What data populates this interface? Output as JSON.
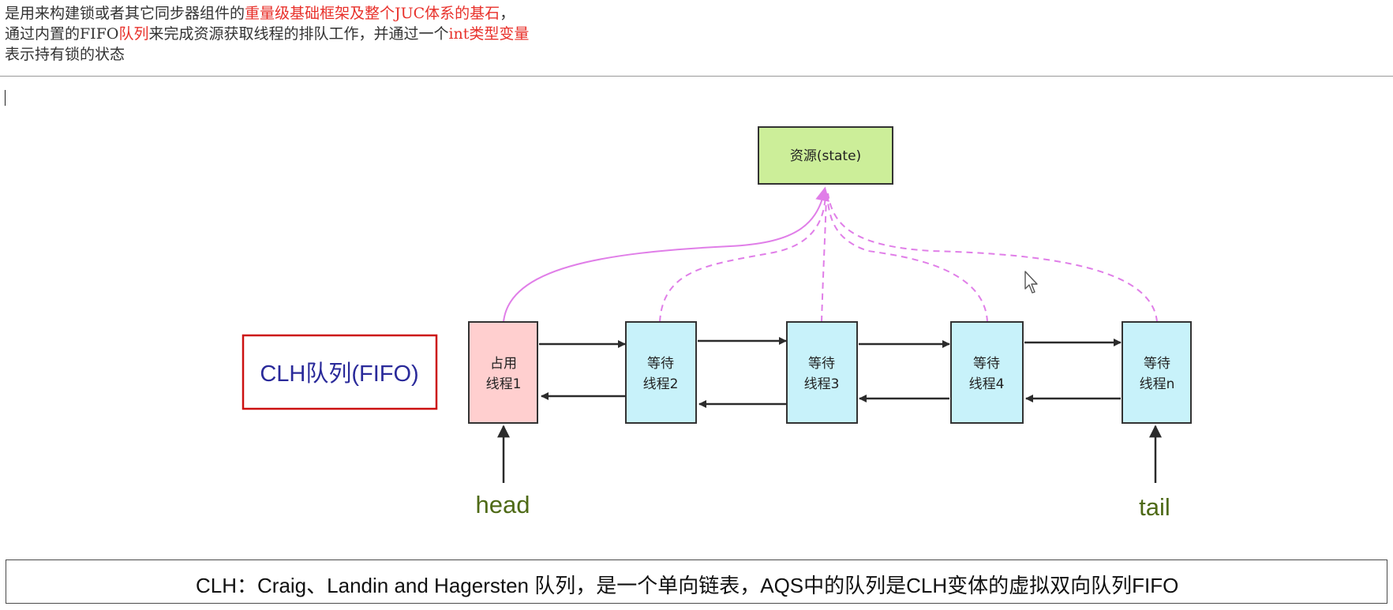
{
  "intro": {
    "l1_a": "是用来构建锁或者其它同步器组件的",
    "l1_b": "重量级基础框架及整个JUC体系的基石",
    "l1_c": "，",
    "l2_a": "通过内置的FIFO",
    "l2_b": "队列",
    "l2_c": "来完成资源获取线程的排队工作，并通过一个",
    "l2_d": "int类型变量",
    "l3": "表示持有锁的状态"
  },
  "diagram": {
    "resource_label": "资源(state)",
    "clh_label": "CLH队列(FIFO)",
    "nodes": [
      {
        "line1": "占用",
        "line2": "线程1",
        "state": "holding"
      },
      {
        "line1": "等待",
        "line2": "线程2",
        "state": "waiting"
      },
      {
        "line1": "等待",
        "line2": "线程3",
        "state": "waiting"
      },
      {
        "line1": "等待",
        "line2": "线程4",
        "state": "waiting"
      },
      {
        "line1": "等待",
        "line2": "线程n",
        "state": "waiting"
      }
    ],
    "head_label": "head",
    "tail_label": "tail"
  },
  "caption": {
    "text": "CLH：Craig、Landin and Hagersten 队列，是一个单向链表，AQS中的队列是CLH变体的虚拟双向队列FIFO"
  },
  "colors": {
    "highlight_red": "#e8302a",
    "resource_fill": "#ccee99",
    "holding_fill": "#ffcfcf",
    "waiting_fill": "#c8f2fa",
    "curve_pink": "#e07ee8",
    "clh_border": "#cc1111",
    "clh_text": "#2a2a9a",
    "pointer_text": "#4e6a16"
  }
}
